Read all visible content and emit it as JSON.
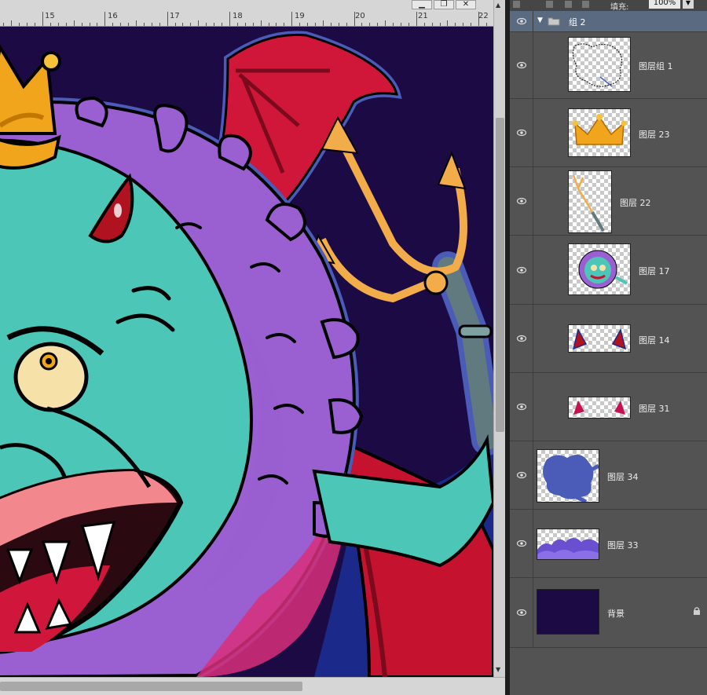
{
  "ruler": {
    "ticks": [
      "15",
      "16",
      "17",
      "18",
      "19",
      "20",
      "21",
      "22"
    ]
  },
  "window": {
    "minimize": "▁",
    "restore": "❐",
    "close": "✕"
  },
  "layers_panel": {
    "fill_label": "填充:",
    "fill_value": "100%",
    "group": {
      "name": "组 2",
      "icon": "folder-icon"
    },
    "layers": [
      {
        "name": "图层组 1"
      },
      {
        "name": "图层 23"
      },
      {
        "name": "图层 22"
      },
      {
        "name": "图层 17"
      },
      {
        "name": "图层 14"
      },
      {
        "name": "图层 31"
      },
      {
        "name": "图层 34"
      },
      {
        "name": "图层 33"
      },
      {
        "name": "背景",
        "locked": true
      }
    ]
  },
  "colors": {
    "artwork_bg": "#1c0a44",
    "virus_body": "#4cc7b7",
    "virus_purple": "#9a5fd0",
    "wing_red": "#c5122f",
    "crown_gold": "#f0a51c",
    "trident": "#f2ad4a",
    "blue_outline": "#4a5bb8",
    "panel_bg": "#535353",
    "selected_group": "#5a6a80"
  }
}
